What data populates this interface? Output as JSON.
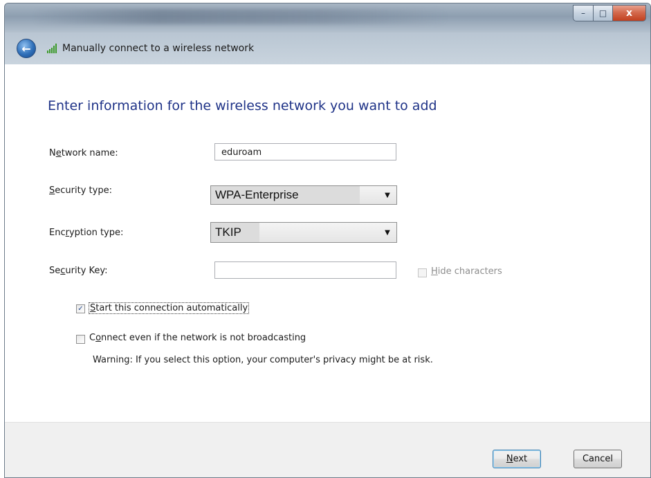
{
  "window": {
    "controls": {
      "minimize": "–",
      "maximize": "□",
      "close": "x"
    }
  },
  "nav": {
    "back_icon": "←",
    "title": "Manually connect to a wireless network"
  },
  "form": {
    "heading": "Enter information for the wireless network you want to add",
    "network_name": {
      "label_pre": "N",
      "label_key": "e",
      "label_post": "twork name:",
      "value": "eduroam"
    },
    "security_type": {
      "label_pre": "",
      "label_key": "S",
      "label_post": "ecurity type:",
      "value": "WPA-Enterprise"
    },
    "encryption_type": {
      "label_pre": "Enc",
      "label_key": "r",
      "label_post": "yption type:",
      "value": "TKIP"
    },
    "security_key": {
      "label_pre": "Se",
      "label_key": "c",
      "label_post": "urity Key:",
      "value": ""
    },
    "hide_characters": {
      "label_key": "H",
      "label_post": "ide characters",
      "checked": false
    },
    "start_automatically": {
      "label_key": "S",
      "label_post": "tart this connection automatically",
      "checked": true
    },
    "connect_not_broadcasting": {
      "label_pre": "C",
      "label_key": "o",
      "label_post": "nnect even if the network is not broadcasting",
      "checked": false
    },
    "warning": "Warning: If you select this option, your computer's privacy might be at risk.",
    "check_mark": "✓",
    "dropdown_arrow": "▼"
  },
  "footer": {
    "next_key": "N",
    "next_post": "ext",
    "cancel_label": "Cancel"
  }
}
